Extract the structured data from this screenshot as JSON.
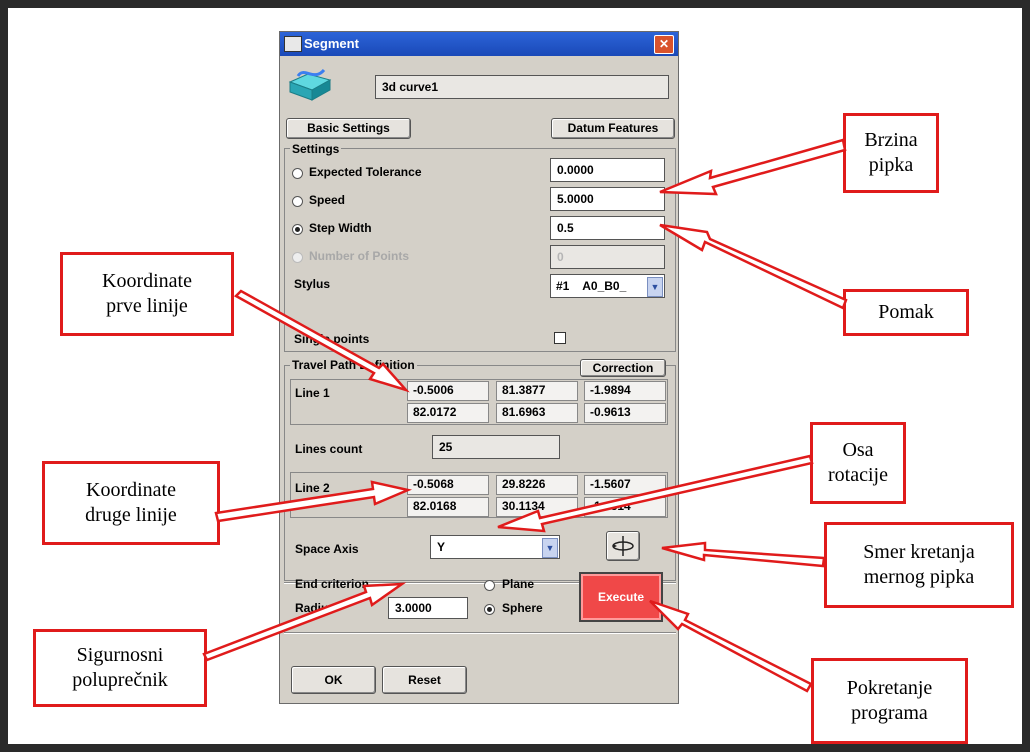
{
  "dialog": {
    "title": "Segment",
    "close_glyph": "✕",
    "feature_name": "3d curve1",
    "buttons": {
      "basic_settings": "Basic Settings",
      "datum_features": "Datum Features",
      "correction": "Correction",
      "execute": "Execute",
      "ok": "OK",
      "reset": "Reset"
    },
    "settings": {
      "group_label": "Settings",
      "expected_tolerance": {
        "label": "Expected Tolerance",
        "value": "0.0000"
      },
      "speed": {
        "label": "Speed",
        "value": "5.0000"
      },
      "step_width": {
        "label": "Step Width",
        "value": "0.5",
        "selected": true
      },
      "number_of_points": {
        "label": "Number of Points",
        "value": "0",
        "disabled": true
      },
      "stylus": {
        "label": "Stylus",
        "value": "#1    A0_B0_"
      },
      "single_points": {
        "label": "Single points",
        "checked": false
      }
    },
    "travel_path": {
      "group_label": "Travel Path Definition",
      "line1": {
        "label": "Line 1",
        "row1": [
          "-0.5006",
          "81.3877",
          "-1.9894"
        ],
        "row2": [
          "82.0172",
          "81.6963",
          "-0.9613"
        ]
      },
      "lines_count": {
        "label": "Lines count",
        "value": "25"
      },
      "line2": {
        "label": "Line 2",
        "row1": [
          "-0.5068",
          "29.8226",
          "-1.5607"
        ],
        "row2": [
          "82.0168",
          "30.1134",
          "-1.4814"
        ]
      },
      "space_axis": {
        "label": "Space Axis",
        "value": "Y"
      }
    },
    "end_criterion": {
      "label": "End criterion",
      "radius_label": "Radius",
      "radius_value": "3.0000",
      "plane_label": "Plane",
      "sphere_label": "Sphere",
      "selected": "Sphere"
    }
  },
  "annotations": {
    "brzina": [
      "Brzina",
      "pipka"
    ],
    "pomak": [
      "Pomak"
    ],
    "koord_prve": [
      "Koordinate",
      "prve linije"
    ],
    "osa": [
      "Osa",
      "rotacije"
    ],
    "koord_druge": [
      "Koordinate",
      "druge linije"
    ],
    "smer": [
      "Smer kretanja",
      "mernog pipka"
    ],
    "sigurnosni": [
      "Sigurnosni",
      "poluprečnik"
    ],
    "pokretanje": [
      "Pokretanje",
      "programa"
    ]
  },
  "colors": {
    "annotation_border": "#e01b1b",
    "execute_bg": "#f04848",
    "titlebar": "#2c64d8"
  }
}
